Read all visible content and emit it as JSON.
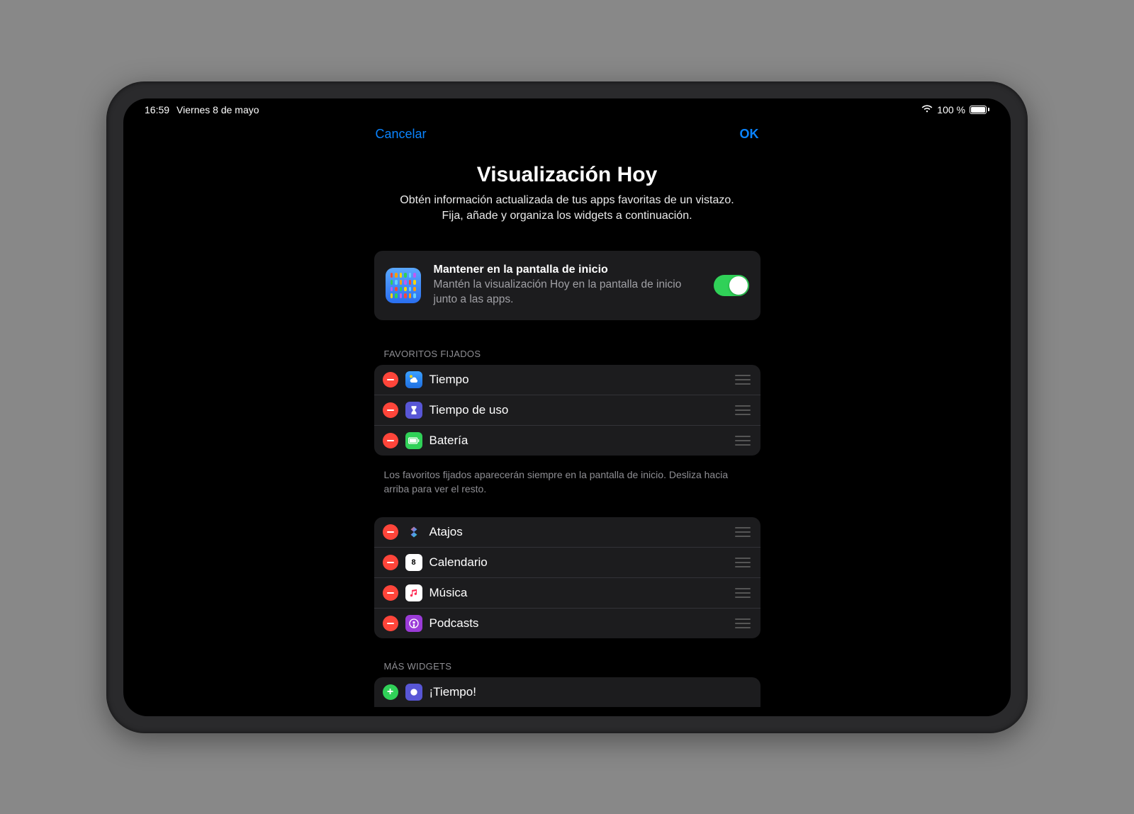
{
  "status": {
    "time": "16:59",
    "date": "Viernes 8 de mayo",
    "battery_pct": "100 %"
  },
  "nav": {
    "cancel": "Cancelar",
    "ok": "OK"
  },
  "header": {
    "title": "Visualización Hoy",
    "subtitle_line1": "Obtén información actualizada de tus apps favoritas de un vistazo.",
    "subtitle_line2": "Fija, añade y organiza los widgets a continuación."
  },
  "keep_card": {
    "title": "Mantener en la pantalla de inicio",
    "desc": "Mantén la visualización Hoy en la pantalla de inicio junto a las apps.",
    "toggle_on": true
  },
  "sections": {
    "pinned_header": "FAVORITOS FIJADOS",
    "pinned_footer": "Los favoritos fijados aparecerán siempre en la pantalla de inicio. Desliza hacia arriba para ver el resto.",
    "more_header": "MÁS WIDGETS"
  },
  "pinned": [
    {
      "label": "Tiempo",
      "icon": "weather"
    },
    {
      "label": "Tiempo de uso",
      "icon": "screentime"
    },
    {
      "label": "Batería",
      "icon": "battery"
    }
  ],
  "favorites": [
    {
      "label": "Atajos",
      "icon": "shortcuts"
    },
    {
      "label": "Calendario",
      "icon": "calendar",
      "badge": "8"
    },
    {
      "label": "Música",
      "icon": "music"
    },
    {
      "label": "Podcasts",
      "icon": "podcasts"
    }
  ],
  "more": [
    {
      "label": "¡Tiempo!",
      "icon": "tiempo2"
    }
  ]
}
